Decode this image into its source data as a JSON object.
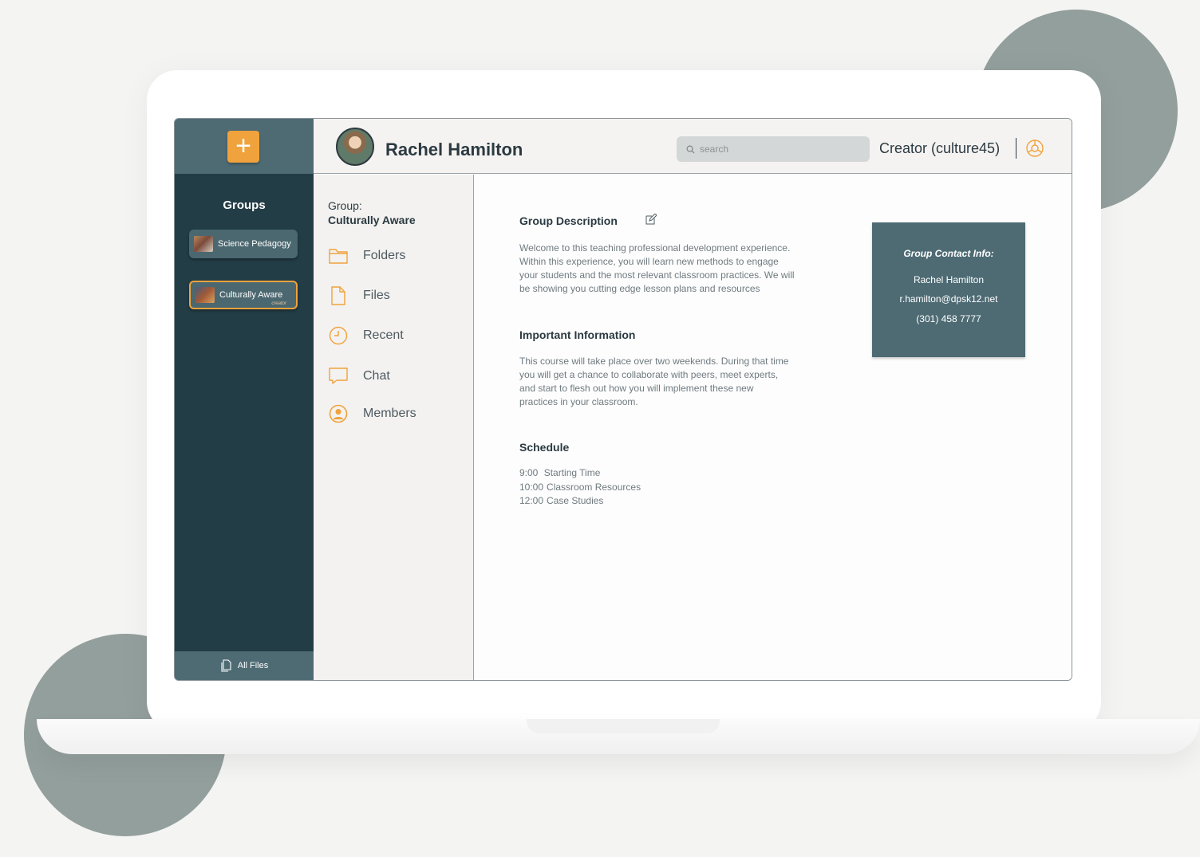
{
  "app": {
    "add_label": "+",
    "colors": {
      "rail": "#233d47",
      "rail_light": "#4e6b74",
      "accent": "#f0a23c",
      "text": "#2b3a42"
    }
  },
  "rail": {
    "title": "Groups",
    "groups": [
      {
        "label": "Science Pedagogy",
        "sub": "",
        "active": false
      },
      {
        "label": "Culturally Aware",
        "sub": "creator",
        "active": true
      }
    ],
    "all_files_label": "All Files"
  },
  "header": {
    "user_name": "Rachel Hamilton",
    "search_placeholder": "search",
    "role": "Creator (culture45)"
  },
  "group_nav": {
    "label": "Group:",
    "name": "Culturally Aware",
    "items": [
      {
        "label": "Folders",
        "icon": "folder-icon"
      },
      {
        "label": "Files",
        "icon": "file-icon"
      },
      {
        "label": "Recent",
        "icon": "clock-icon"
      },
      {
        "label": "Chat",
        "icon": "chat-icon"
      },
      {
        "label": "Members",
        "icon": "user-circle-icon"
      }
    ]
  },
  "content": {
    "description_title": "Group Description",
    "description_lines": [
      "Welcome to this teaching professional development experience.",
      "Within this experience, you will learn new methods to engage",
      "your students and the most relevant classroom practices. We will",
      "be showing you cutting edge lesson plans and resources"
    ],
    "important_title": "Important Information",
    "important_lines": [
      "This course will take place over two weekends. During that time",
      "you will get a chance to collaborate with peers, meet experts,",
      "and start to flesh out how you will implement these new",
      "practices in your classroom."
    ],
    "schedule_title": "Schedule",
    "schedule": [
      {
        "time": "9:00",
        "label": "Starting Time"
      },
      {
        "time": "10:00",
        "label": "Classroom Resources"
      },
      {
        "time": "12:00",
        "label": "Case Studies"
      }
    ]
  },
  "contact": {
    "title": "Group Contact Info:",
    "name": "Rachel Hamilton",
    "email": "r.hamilton@dpsk12.net",
    "phone": "(301) 458 7777"
  }
}
